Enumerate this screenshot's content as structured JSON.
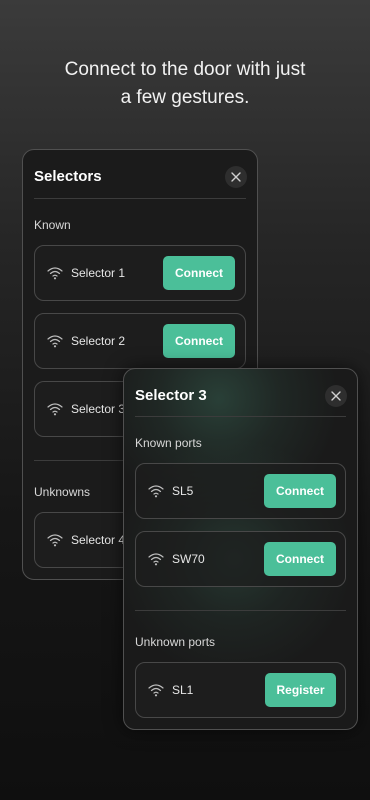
{
  "headline": {
    "line1": "Connect to the door with just",
    "line2": "a few gestures."
  },
  "selectors_panel": {
    "title": "Selectors",
    "known_label": "Known",
    "unknowns_label": "Unknowns",
    "known_items": [
      {
        "name": "Selector 1",
        "action": "Connect"
      },
      {
        "name": "Selector 2",
        "action": "Connect"
      },
      {
        "name": "Selector 3"
      }
    ],
    "unknown_items": [
      {
        "name": "Selector 4"
      }
    ]
  },
  "selector3_panel": {
    "title": "Selector 3",
    "known_ports_label": "Known ports",
    "unknown_ports_label": "Unknown ports",
    "known_ports": [
      {
        "name": "SL5",
        "action": "Connect"
      },
      {
        "name": "SW70",
        "action": "Connect"
      }
    ],
    "unknown_ports": [
      {
        "name": "SL1",
        "action": "Register"
      }
    ]
  },
  "colors": {
    "accent": "#4bbf99",
    "background": "#1a1a1a"
  },
  "icons": [
    "wifi-icon",
    "close-icon"
  ]
}
